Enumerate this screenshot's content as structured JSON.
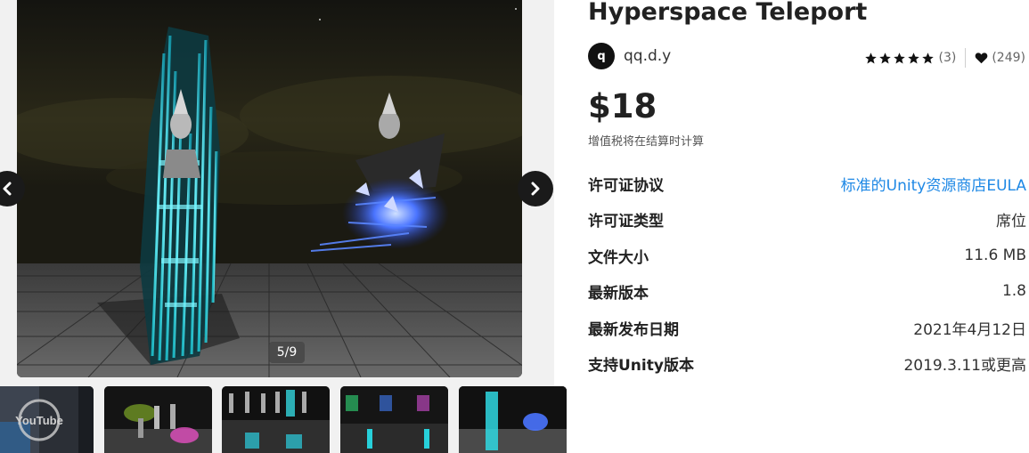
{
  "gallery": {
    "counter": "5/9",
    "youtube_label": "YouTube"
  },
  "product": {
    "title": "Hyperspace Teleport",
    "publisher": {
      "avatar_letter": "q",
      "name": "qq.d.y"
    },
    "rating": {
      "stars": 5,
      "count": "(3)",
      "favorites": "(249)"
    },
    "price": "$18",
    "tax_note": "增值税将在结算时计算"
  },
  "specs": [
    {
      "label": "许可证协议",
      "value": "标准的Unity资源商店EULA"
    },
    {
      "label": "许可证类型",
      "value": "席位"
    },
    {
      "label": "文件大小",
      "value": "11.6 MB"
    },
    {
      "label": "最新版本",
      "value": "1.8"
    },
    {
      "label": "最新发布日期",
      "value": "2021年4月12日"
    },
    {
      "label": "支持Unity版本",
      "value": "2019.3.11或更高"
    }
  ],
  "colors": {
    "accent_link": "#1e88e5",
    "text_primary": "#212121",
    "glow_cyan": "#29e6ee",
    "glow_blue": "#3d6bff"
  }
}
